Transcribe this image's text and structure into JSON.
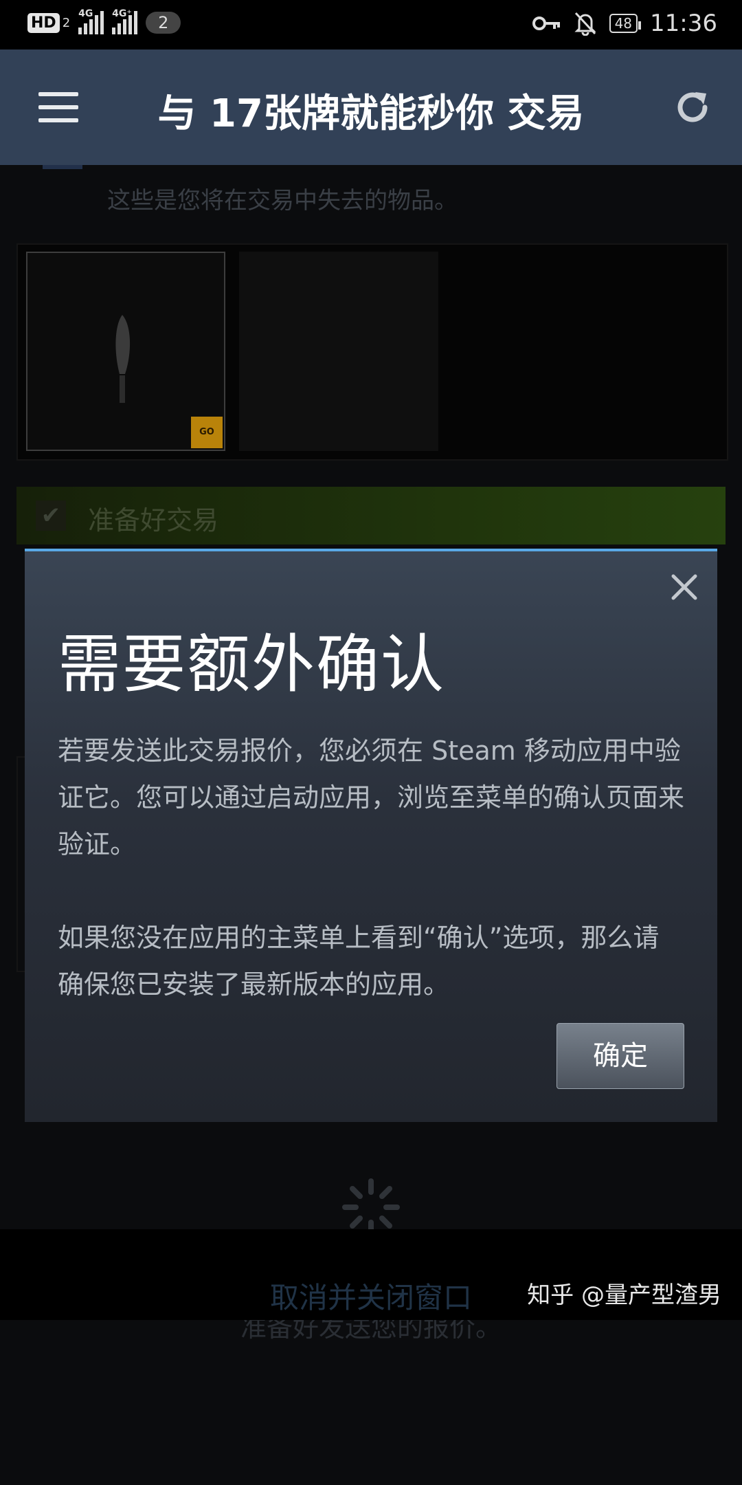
{
  "status_bar": {
    "hd_label": "HD",
    "hd_sub": "2",
    "signal1_tag": "4G",
    "signal2_tag": "4G⁺",
    "notification_count": "2",
    "battery_level": "48",
    "time": "11:36"
  },
  "header": {
    "title": "与 17张牌就能秒你 交易"
  },
  "background": {
    "lose_items_note": "这些是您将在交易中失去的物品。",
    "game_badge": "GO",
    "ready_label": "准备好交易",
    "status_text": "准备好发送您的报价。",
    "cancel_link": "取消并关闭窗口"
  },
  "modal": {
    "title": "需要额外确认",
    "paragraph1": "若要发送此交易报价，您必须在 Steam 移动应用中验证它。您可以通过启动应用，浏览至菜单的确认页面来验证。",
    "paragraph2": "如果您没在应用的主菜单上看到“确认”选项，那么请确保您已安装了最新版本的应用。",
    "ok_label": "确定"
  },
  "watermark": "知乎 @量产型渣男",
  "colors": {
    "header_bg": "#324157",
    "modal_accent": "#59a8e6",
    "ready_green": "#26410e"
  }
}
